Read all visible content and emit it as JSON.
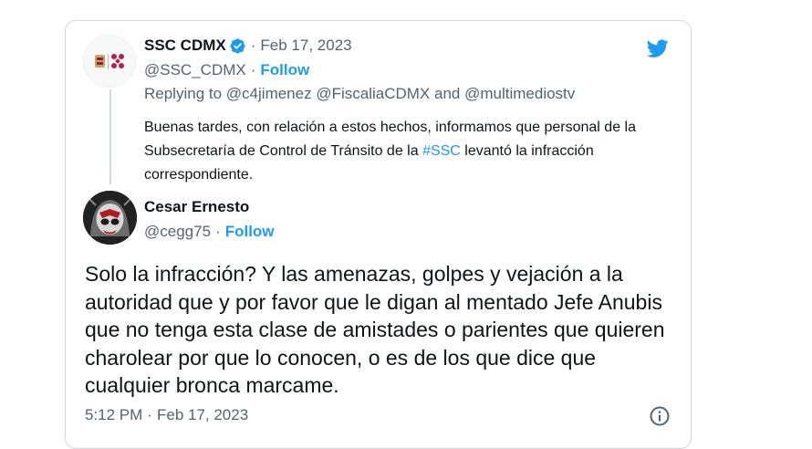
{
  "quoted": {
    "display_name": "SSC CDMX",
    "verified": true,
    "date": "Feb 17, 2023",
    "handle": "@SSC_CDMX",
    "follow_label": "Follow",
    "replying_prefix": "Replying to",
    "replying_to": [
      "@c4jimenez",
      "@FiscaliaCDMX"
    ],
    "replying_and": "and",
    "replying_last": "@multimediostv",
    "body_before": "Buenas tardes, con relación a estos hechos, informamos que personal de la Subsecretaría de Control de Tránsito de la ",
    "hashtag": "#SSC",
    "body_after": " levantó la infracción correspondiente."
  },
  "reply": {
    "display_name": "Cesar Ernesto",
    "handle": "@cegg75",
    "follow_label": "Follow",
    "body": "Solo la infracción? Y las amenazas, golpes y vejación a la autoridad que y por favor que le digan al mentado Jefe Anubis que no tenga esta clase de amistades o parientes que quieren charolear por que lo conocen, o es de los que dice que cualquier bronca marcame.",
    "time": "5:12 PM",
    "date": "Feb 17, 2023"
  },
  "separator": "·",
  "icons": {
    "brand": "twitter-bird-icon",
    "verified": "verified-badge-icon",
    "info": "info-icon"
  },
  "colors": {
    "accent": "#1d9bf0",
    "text": "#0f1419",
    "secondary": "#536471",
    "border": "#cfd9de"
  }
}
